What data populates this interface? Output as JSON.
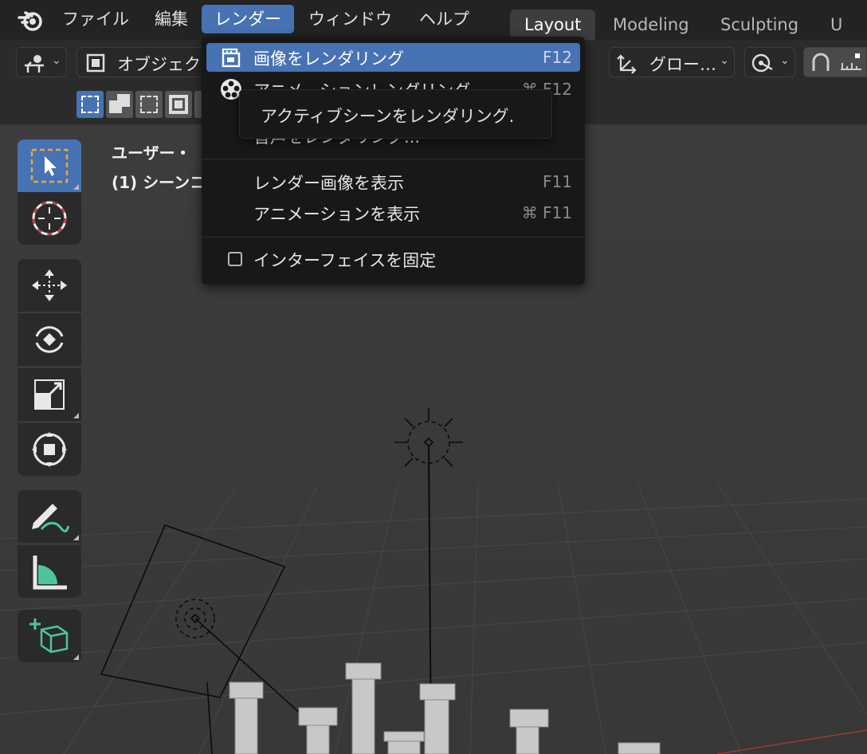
{
  "topbar": {
    "menus": [
      "ファイル",
      "編集",
      "レンダー",
      "ウィンドウ",
      "ヘルプ"
    ],
    "active_menu": "レンダー",
    "workspace_tabs": [
      "Layout",
      "Modeling",
      "Sculpting",
      "U"
    ],
    "active_tab": "Layout"
  },
  "header": {
    "mode_label": "オブジェク",
    "transform_orientation": "グロー…"
  },
  "viewport": {
    "view_name": "ユーザー・",
    "scene_info": "(1) シーンコ"
  },
  "render_menu": {
    "items": [
      {
        "label": "画像をレンダリング",
        "shortcut": "F12",
        "icon": "render-still-icon",
        "highlighted": true
      },
      {
        "label": "アニメーションレンダリング",
        "shortcut": "⌘ F12",
        "icon": "render-animation-icon"
      },
      {
        "label": "音声をレンダリング...",
        "shortcut": ""
      },
      {
        "label": "レンダー画像を表示",
        "shortcut": "F11"
      },
      {
        "label": "アニメーションを表示",
        "shortcut": "⌘ F11"
      },
      {
        "label": "インターフェイスを固定",
        "shortcut": "",
        "checkbox": false
      }
    ]
  },
  "tooltip": {
    "text": "アクティブシーンをレンダリング."
  },
  "toolbar": {
    "tools": [
      "select-box",
      "cursor",
      "move",
      "rotate",
      "scale",
      "transform",
      "annotate",
      "measure",
      "add-cube"
    ],
    "active_tool": "select-box"
  },
  "colors": {
    "accent": "#4772b3",
    "menu_bg": "#181818",
    "topbar_bg": "#232323"
  }
}
